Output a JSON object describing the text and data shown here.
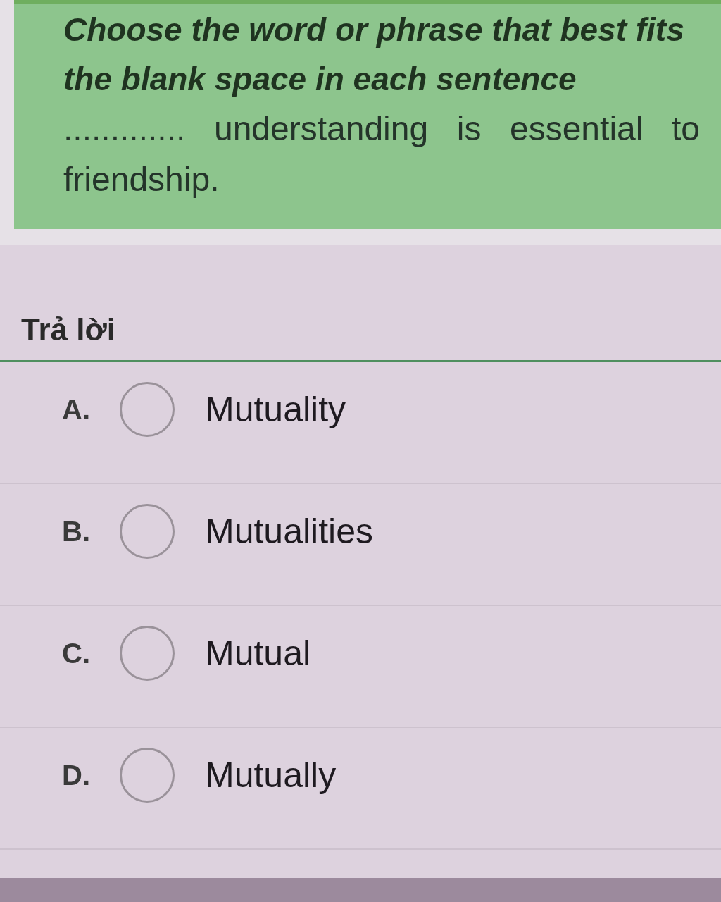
{
  "question": {
    "instruction": "Choose the word or phrase that best fits the blank space in each sentence",
    "sentence": "............. understanding is essential to friendship."
  },
  "answer_section": {
    "title": "Trả lời",
    "options": [
      {
        "letter": "A.",
        "text": "Mutuality",
        "selected": false
      },
      {
        "letter": "B.",
        "text": "Mutualities",
        "selected": false
      },
      {
        "letter": "C.",
        "text": "Mutual",
        "selected": false
      },
      {
        "letter": "D.",
        "text": "Mutually",
        "selected": false
      }
    ]
  }
}
